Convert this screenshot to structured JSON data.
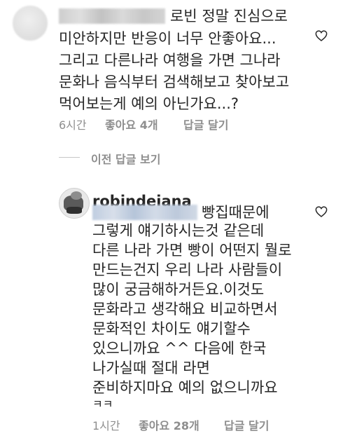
{
  "comment": {
    "lines": [
      "로빈 정말 진심으로",
      "미안하지만 반응이 너무 안좋아요...",
      "그리고 다른나라 여행을 가면 그나라",
      "문화나 음식부터 검색해보고 찾아보고",
      "먹어보는게 예의 아닌가요...?"
    ],
    "time": "6시간",
    "likes_label": "좋아요 4개",
    "reply_label": "답글 달기"
  },
  "view_replies_label": "이전 답글 보기",
  "reply": {
    "username": "robindeiana",
    "lines": [
      "빵집때문에",
      "그렇게 얘기하시는것 같은데",
      "다른 나라 가면 빵이 어떤지 뭘로",
      "만드는건지 우리 나라 사람들이",
      "많이 궁금해하거든요.이것도",
      "문화라고 생각해요 비교하면서",
      "문화적인 차이도 얘기할수",
      "있으니까요 ^^ 다음에 한국",
      "나가실때 절대 라면",
      "준비하지마요 예의 없으니까요",
      "ㅋㅋ"
    ],
    "time": "1시간",
    "likes_label": "좋아요 28개",
    "reply_label": "답글 달기"
  },
  "icons": {
    "heart": "heart-outline-icon"
  }
}
